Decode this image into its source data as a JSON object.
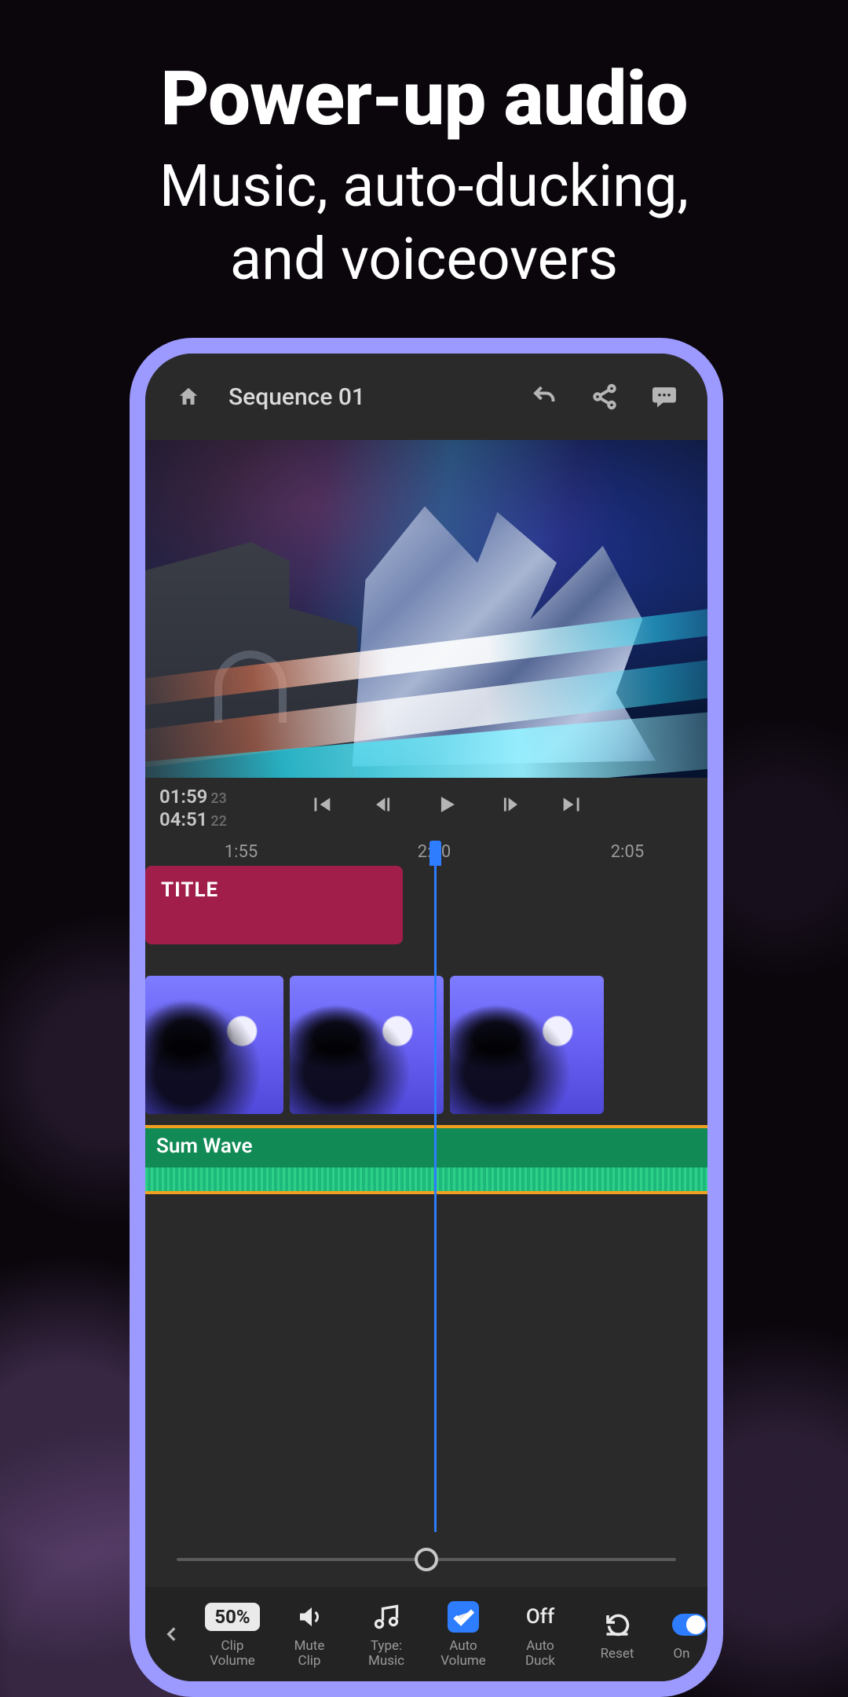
{
  "promo": {
    "title": "Power-up audio",
    "subtitle_l1": "Music, auto-ducking,",
    "subtitle_l2": "and voiceovers"
  },
  "header": {
    "sequence_name": "Sequence 01"
  },
  "transport": {
    "current_time": "01:59",
    "current_frames": "23",
    "total_time": "04:51",
    "total_frames": "22"
  },
  "ruler": {
    "ticks": [
      "1:55",
      "2:00",
      "2:05"
    ]
  },
  "tracks": {
    "title_clip_label": "TITLE",
    "audio_clip_label": "Sum Wave"
  },
  "toolbar": {
    "items": [
      {
        "id": "clip-volume",
        "value": "50%",
        "label_l1": "Clip",
        "label_l2": "Volume"
      },
      {
        "id": "mute-clip",
        "icon": "volume",
        "label_l1": "Mute",
        "label_l2": "Clip"
      },
      {
        "id": "type-music",
        "icon": "music",
        "label_l1": "Type:",
        "label_l2": "Music"
      },
      {
        "id": "auto-volume",
        "icon": "check",
        "label_l1": "Auto",
        "label_l2": "Volume"
      },
      {
        "id": "auto-duck",
        "value": "Off",
        "label_l1": "Auto",
        "label_l2": "Duck"
      },
      {
        "id": "reset",
        "icon": "reset",
        "label_l1": "Reset",
        "label_l2": ""
      },
      {
        "id": "on-toggle",
        "icon": "toggle",
        "label_l1": "On",
        "label_l2": ""
      }
    ]
  }
}
